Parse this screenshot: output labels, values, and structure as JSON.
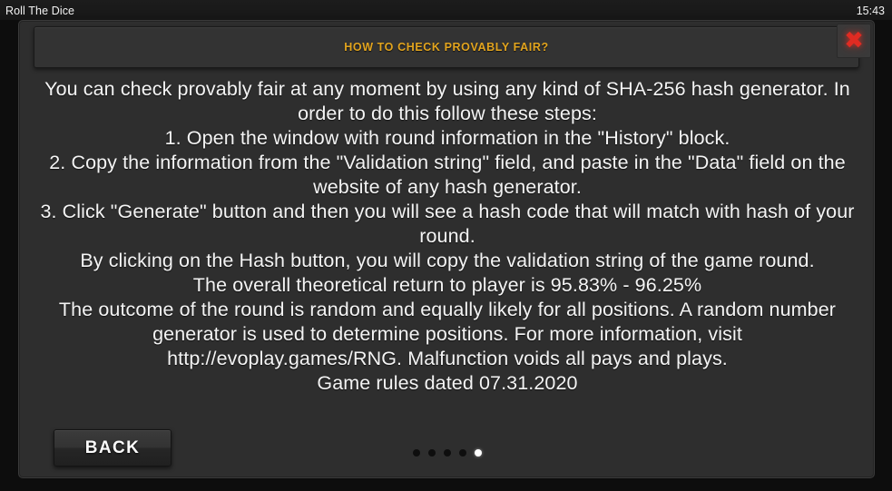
{
  "topbar": {
    "app_title": "Roll The Dice",
    "clock": "15:43"
  },
  "dialog": {
    "header_title": "HOW TO CHECK PROVABLY FAIR?",
    "close_icon": "close-x-icon",
    "close_icon_glyph": "✖",
    "accent_color": "#e2a41e",
    "close_color": "#e02b22",
    "paragraphs": [
      "You can check provably fair at any moment by using any kind of SHA-256 hash generator. In order to do this follow these steps:",
      "1. Open the window with round information in the \"History\" block.",
      "2. Copy the information from the \"Validation string\" field, and paste in the \"Data\" field on the website of any hash generator.",
      "3. Click \"Generate\" button and then you will see a hash code that will match with hash of your round.",
      "By clicking on the Hash button, you will copy the validation string of the game round.",
      "The overall theoretical return to player is 95.83% - 96.25%",
      "The outcome of the round is random and equally likely for all positions. A random number generator is used to determine positions. For more information, visit http://evoplay.games/RNG. Malfunction voids all pays and plays.",
      "Game rules dated 07.31.2020"
    ]
  },
  "footer": {
    "back_label": "BACK",
    "pagination": {
      "total": 5,
      "active_index": 4
    }
  }
}
